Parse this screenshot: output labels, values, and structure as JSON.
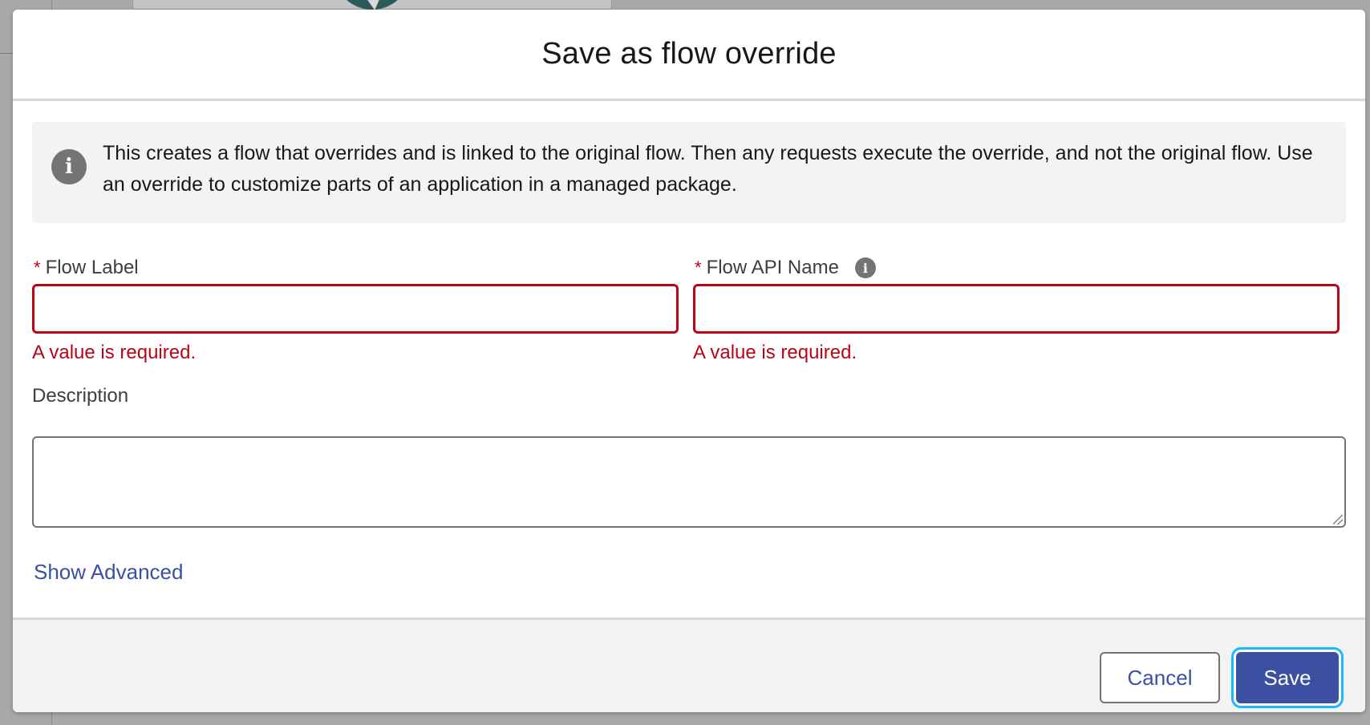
{
  "modal": {
    "title": "Save as flow override"
  },
  "info": {
    "icon": "info-icon",
    "text": "This creates a flow that overrides and is linked to the original flow. Then any requests execute the override, and not the original flow. Use an override to customize parts of an application in a managed package."
  },
  "fields": {
    "required_marker": "*",
    "flow_label": {
      "label": "Flow Label",
      "value": "",
      "error": "A value is required."
    },
    "flow_api_name": {
      "label": "Flow API Name",
      "help_icon": "info-icon",
      "value": "",
      "error": "A value is required."
    },
    "description": {
      "label": "Description",
      "value": ""
    }
  },
  "links": {
    "show_advanced": "Show Advanced"
  },
  "footer": {
    "cancel_label": "Cancel",
    "save_label": "Save"
  },
  "colors": {
    "brand": "#3b50a1",
    "error": "#ba0517",
    "focus_ring": "#1ab9ff"
  }
}
